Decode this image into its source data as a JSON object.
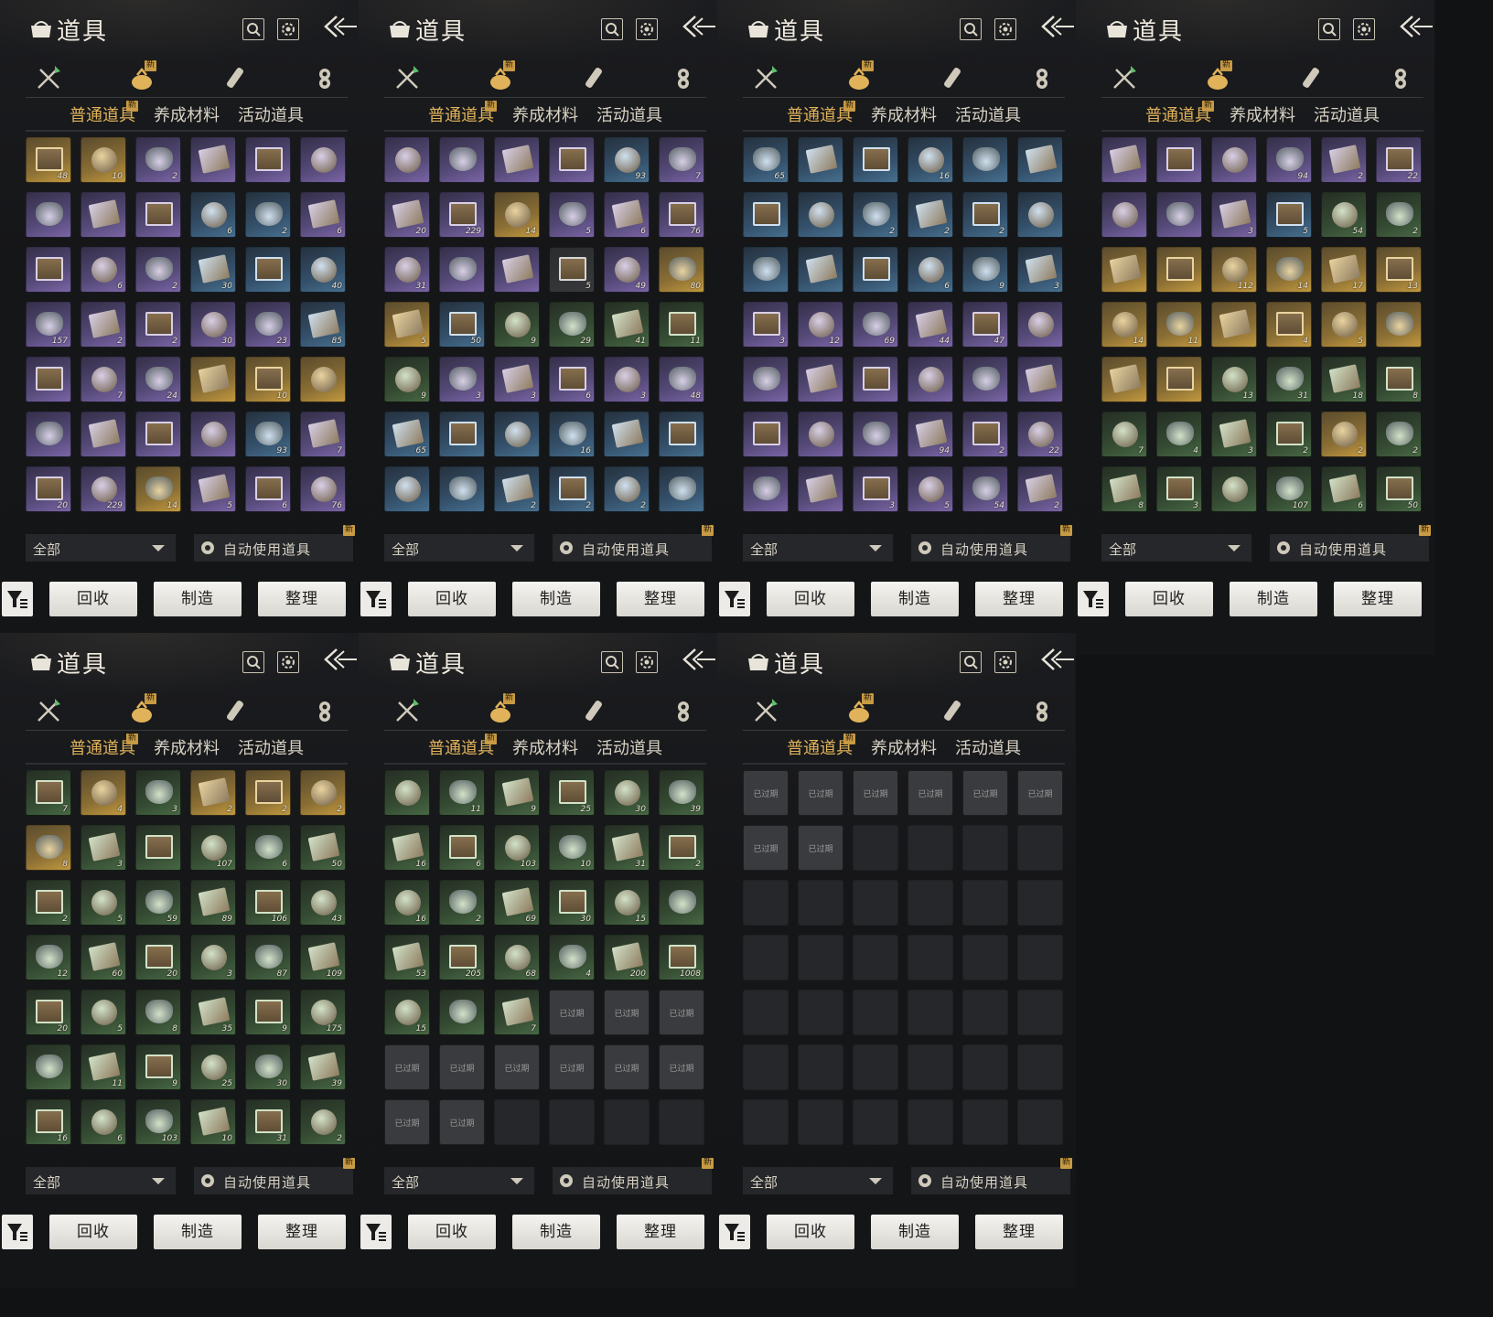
{
  "common": {
    "title": "道具",
    "new_badge": "新",
    "subtabs": [
      "普通道具",
      "养成材料",
      "活动道具"
    ],
    "filter_value": "全部",
    "auto_use_label": "自动使用道具",
    "buttons": {
      "recycle": "回收",
      "craft": "制造",
      "sort": "整理"
    },
    "expired_label": "已过期",
    "colors": {
      "accent": "#e0b25a",
      "badge": "#c79a44",
      "button": "#f4f3ef",
      "panel": "#17181a"
    }
  },
  "panels": [
    {
      "items": [
        {
          "r": "gold",
          "c": "48"
        },
        {
          "r": "gold",
          "c": "10"
        },
        {
          "r": "purple",
          "c": "2"
        },
        {
          "r": "purple",
          "c": ""
        },
        {
          "r": "purple",
          "c": ""
        },
        {
          "r": "purple",
          "c": ""
        },
        {
          "r": "purple",
          "c": ""
        },
        {
          "r": "purple",
          "c": ""
        },
        {
          "r": "purple",
          "c": ""
        },
        {
          "r": "blue",
          "c": "6"
        },
        {
          "r": "blue",
          "c": "2"
        },
        {
          "r": "purple",
          "c": "6"
        },
        {
          "r": "purple",
          "c": ""
        },
        {
          "r": "purple",
          "c": "6"
        },
        {
          "r": "purple",
          "c": "2"
        },
        {
          "r": "blue",
          "c": "30"
        },
        {
          "r": "blue",
          "c": ""
        },
        {
          "r": "blue",
          "c": "40"
        },
        {
          "r": "purple",
          "c": "157"
        },
        {
          "r": "purple",
          "c": "2"
        },
        {
          "r": "purple",
          "c": "2"
        },
        {
          "r": "purple",
          "c": "30"
        },
        {
          "r": "purple",
          "c": "23"
        },
        {
          "r": "blue",
          "c": "85"
        },
        {
          "r": "purple",
          "c": ""
        },
        {
          "r": "purple",
          "c": "7"
        },
        {
          "r": "purple",
          "c": "24"
        },
        {
          "r": "gold",
          "c": ""
        },
        {
          "r": "gold",
          "c": "10"
        },
        {
          "r": "gold",
          "c": ""
        },
        {
          "r": "purple",
          "c": ""
        },
        {
          "r": "purple",
          "c": ""
        },
        {
          "r": "purple",
          "c": ""
        },
        {
          "r": "purple",
          "c": ""
        },
        {
          "r": "blue",
          "c": "93"
        },
        {
          "r": "purple",
          "c": "7"
        },
        {
          "r": "purple",
          "c": "20"
        },
        {
          "r": "purple",
          "c": "229"
        },
        {
          "r": "gold",
          "c": "14"
        },
        {
          "r": "purple",
          "c": "5"
        },
        {
          "r": "purple",
          "c": "6"
        },
        {
          "r": "purple",
          "c": "76"
        }
      ]
    },
    {
      "items": [
        {
          "r": "purple",
          "c": ""
        },
        {
          "r": "purple",
          "c": ""
        },
        {
          "r": "purple",
          "c": ""
        },
        {
          "r": "purple",
          "c": ""
        },
        {
          "r": "blue",
          "c": "93"
        },
        {
          "r": "purple",
          "c": "7"
        },
        {
          "r": "purple",
          "c": "20"
        },
        {
          "r": "purple",
          "c": "229"
        },
        {
          "r": "gold",
          "c": "14"
        },
        {
          "r": "purple",
          "c": "5"
        },
        {
          "r": "purple",
          "c": "6"
        },
        {
          "r": "purple",
          "c": "76"
        },
        {
          "r": "purple",
          "c": "31"
        },
        {
          "r": "purple",
          "c": ""
        },
        {
          "r": "purple",
          "c": ""
        },
        {
          "r": "gray",
          "c": "5"
        },
        {
          "r": "purple",
          "c": "49"
        },
        {
          "r": "gold",
          "c": "80"
        },
        {
          "r": "gold",
          "c": "5"
        },
        {
          "r": "blue",
          "c": "50"
        },
        {
          "r": "green",
          "c": "9"
        },
        {
          "r": "green",
          "c": "29"
        },
        {
          "r": "green",
          "c": "41"
        },
        {
          "r": "green",
          "c": "11"
        },
        {
          "r": "green",
          "c": "9"
        },
        {
          "r": "purple",
          "c": "3"
        },
        {
          "r": "purple",
          "c": "3"
        },
        {
          "r": "purple",
          "c": "6"
        },
        {
          "r": "purple",
          "c": "3"
        },
        {
          "r": "purple",
          "c": "48"
        },
        {
          "r": "blue",
          "c": "65"
        },
        {
          "r": "blue",
          "c": ""
        },
        {
          "r": "blue",
          "c": ""
        },
        {
          "r": "blue",
          "c": "16"
        },
        {
          "r": "blue",
          "c": ""
        },
        {
          "r": "blue",
          "c": ""
        },
        {
          "r": "blue",
          "c": ""
        },
        {
          "r": "blue",
          "c": ""
        },
        {
          "r": "blue",
          "c": "2"
        },
        {
          "r": "blue",
          "c": "2"
        },
        {
          "r": "blue",
          "c": "2"
        },
        {
          "r": "blue",
          "c": ""
        }
      ]
    },
    {
      "items": [
        {
          "r": "blue",
          "c": "65"
        },
        {
          "r": "blue",
          "c": ""
        },
        {
          "r": "blue",
          "c": ""
        },
        {
          "r": "blue",
          "c": "16"
        },
        {
          "r": "blue",
          "c": ""
        },
        {
          "r": "blue",
          "c": ""
        },
        {
          "r": "blue",
          "c": ""
        },
        {
          "r": "blue",
          "c": ""
        },
        {
          "r": "blue",
          "c": "2"
        },
        {
          "r": "blue",
          "c": "2"
        },
        {
          "r": "blue",
          "c": "2"
        },
        {
          "r": "blue",
          "c": ""
        },
        {
          "r": "blue",
          "c": ""
        },
        {
          "r": "blue",
          "c": ""
        },
        {
          "r": "blue",
          "c": ""
        },
        {
          "r": "blue",
          "c": "6"
        },
        {
          "r": "blue",
          "c": "9"
        },
        {
          "r": "blue",
          "c": "3"
        },
        {
          "r": "purple",
          "c": "3"
        },
        {
          "r": "purple",
          "c": "12"
        },
        {
          "r": "purple",
          "c": "69"
        },
        {
          "r": "purple",
          "c": "44"
        },
        {
          "r": "purple",
          "c": "47"
        },
        {
          "r": "purple",
          "c": ""
        },
        {
          "r": "purple",
          "c": ""
        },
        {
          "r": "purple",
          "c": ""
        },
        {
          "r": "purple",
          "c": ""
        },
        {
          "r": "purple",
          "c": ""
        },
        {
          "r": "purple",
          "c": ""
        },
        {
          "r": "purple",
          "c": ""
        },
        {
          "r": "purple",
          "c": ""
        },
        {
          "r": "purple",
          "c": ""
        },
        {
          "r": "purple",
          "c": ""
        },
        {
          "r": "purple",
          "c": "94"
        },
        {
          "r": "purple",
          "c": "2"
        },
        {
          "r": "purple",
          "c": "22"
        },
        {
          "r": "purple",
          "c": ""
        },
        {
          "r": "purple",
          "c": ""
        },
        {
          "r": "purple",
          "c": "3"
        },
        {
          "r": "purple",
          "c": "5"
        },
        {
          "r": "purple",
          "c": "54"
        },
        {
          "r": "purple",
          "c": "2"
        }
      ]
    },
    {
      "items": [
        {
          "r": "purple",
          "c": ""
        },
        {
          "r": "purple",
          "c": ""
        },
        {
          "r": "purple",
          "c": ""
        },
        {
          "r": "purple",
          "c": "94"
        },
        {
          "r": "purple",
          "c": "2"
        },
        {
          "r": "purple",
          "c": "22"
        },
        {
          "r": "purple",
          "c": ""
        },
        {
          "r": "purple",
          "c": ""
        },
        {
          "r": "purple",
          "c": "3"
        },
        {
          "r": "blue",
          "c": "5"
        },
        {
          "r": "green",
          "c": "54"
        },
        {
          "r": "green",
          "c": "2"
        },
        {
          "r": "gold",
          "c": ""
        },
        {
          "r": "gold",
          "c": ""
        },
        {
          "r": "gold",
          "c": "112"
        },
        {
          "r": "gold",
          "c": "14"
        },
        {
          "r": "gold",
          "c": "17"
        },
        {
          "r": "gold",
          "c": "13"
        },
        {
          "r": "gold",
          "c": "14"
        },
        {
          "r": "gold",
          "c": "11"
        },
        {
          "r": "gold",
          "c": ""
        },
        {
          "r": "gold",
          "c": "4"
        },
        {
          "r": "gold",
          "c": "5"
        },
        {
          "r": "gold",
          "c": ""
        },
        {
          "r": "gold",
          "c": ""
        },
        {
          "r": "gold",
          "c": ""
        },
        {
          "r": "green",
          "c": "13"
        },
        {
          "r": "green",
          "c": "31"
        },
        {
          "r": "green",
          "c": "18"
        },
        {
          "r": "green",
          "c": "8"
        },
        {
          "r": "green",
          "c": "7"
        },
        {
          "r": "green",
          "c": "4"
        },
        {
          "r": "green",
          "c": "3"
        },
        {
          "r": "green",
          "c": "2"
        },
        {
          "r": "gold",
          "c": "2"
        },
        {
          "r": "green",
          "c": "2"
        },
        {
          "r": "green",
          "c": "8"
        },
        {
          "r": "green",
          "c": "3"
        },
        {
          "r": "green",
          "c": ""
        },
        {
          "r": "green",
          "c": "107"
        },
        {
          "r": "green",
          "c": "6"
        },
        {
          "r": "green",
          "c": "50"
        }
      ]
    },
    {
      "items": [
        {
          "r": "green",
          "c": "7"
        },
        {
          "r": "gold",
          "c": "4"
        },
        {
          "r": "green",
          "c": "3"
        },
        {
          "r": "gold",
          "c": "2"
        },
        {
          "r": "gold",
          "c": "2"
        },
        {
          "r": "gold",
          "c": "2"
        },
        {
          "r": "gold",
          "c": "8"
        },
        {
          "r": "green",
          "c": "3"
        },
        {
          "r": "green",
          "c": ""
        },
        {
          "r": "green",
          "c": "107"
        },
        {
          "r": "green",
          "c": "6"
        },
        {
          "r": "green",
          "c": "50"
        },
        {
          "r": "green",
          "c": "2"
        },
        {
          "r": "green",
          "c": "5"
        },
        {
          "r": "green",
          "c": "59"
        },
        {
          "r": "green",
          "c": "89"
        },
        {
          "r": "green",
          "c": "106"
        },
        {
          "r": "green",
          "c": "43"
        },
        {
          "r": "green",
          "c": "12"
        },
        {
          "r": "green",
          "c": "60"
        },
        {
          "r": "green",
          "c": "20"
        },
        {
          "r": "green",
          "c": "3"
        },
        {
          "r": "green",
          "c": "87"
        },
        {
          "r": "green",
          "c": "109"
        },
        {
          "r": "green",
          "c": "20"
        },
        {
          "r": "green",
          "c": "5"
        },
        {
          "r": "green",
          "c": "8"
        },
        {
          "r": "green",
          "c": "35"
        },
        {
          "r": "green",
          "c": "9"
        },
        {
          "r": "green",
          "c": "175"
        },
        {
          "r": "green",
          "c": ""
        },
        {
          "r": "green",
          "c": "11"
        },
        {
          "r": "green",
          "c": "9"
        },
        {
          "r": "green",
          "c": "25"
        },
        {
          "r": "green",
          "c": "30"
        },
        {
          "r": "green",
          "c": "39"
        },
        {
          "r": "green",
          "c": "16"
        },
        {
          "r": "green",
          "c": "6"
        },
        {
          "r": "green",
          "c": "103"
        },
        {
          "r": "green",
          "c": "10"
        },
        {
          "r": "green",
          "c": "31"
        },
        {
          "r": "green",
          "c": "2"
        }
      ]
    },
    {
      "items": [
        {
          "r": "green",
          "c": ""
        },
        {
          "r": "green",
          "c": "11"
        },
        {
          "r": "green",
          "c": "9"
        },
        {
          "r": "green",
          "c": "25"
        },
        {
          "r": "green",
          "c": "30"
        },
        {
          "r": "green",
          "c": "39"
        },
        {
          "r": "green",
          "c": "16"
        },
        {
          "r": "green",
          "c": "6"
        },
        {
          "r": "green",
          "c": "103"
        },
        {
          "r": "green",
          "c": "10"
        },
        {
          "r": "green",
          "c": "31"
        },
        {
          "r": "green",
          "c": "2"
        },
        {
          "r": "green",
          "c": "16"
        },
        {
          "r": "green",
          "c": "2"
        },
        {
          "r": "green",
          "c": "69"
        },
        {
          "r": "green",
          "c": "30"
        },
        {
          "r": "green",
          "c": "15"
        },
        {
          "r": "green",
          "c": ""
        },
        {
          "r": "green",
          "c": "53"
        },
        {
          "r": "green",
          "c": "205"
        },
        {
          "r": "green",
          "c": "68"
        },
        {
          "r": "green",
          "c": "4"
        },
        {
          "r": "green",
          "c": "200"
        },
        {
          "r": "green",
          "c": "1008"
        },
        {
          "r": "green",
          "c": "15"
        },
        {
          "r": "green",
          "c": ""
        },
        {
          "r": "green",
          "c": "7"
        },
        {
          "r": "expired",
          "c": ""
        },
        {
          "r": "expired",
          "c": ""
        },
        {
          "r": "expired",
          "c": ""
        },
        {
          "r": "expired",
          "c": ""
        },
        {
          "r": "expired",
          "c": ""
        },
        {
          "r": "expired",
          "c": ""
        },
        {
          "r": "expired",
          "c": ""
        },
        {
          "r": "expired",
          "c": ""
        },
        {
          "r": "expired",
          "c": ""
        },
        {
          "r": "expired",
          "c": ""
        },
        {
          "r": "expired",
          "c": ""
        },
        {
          "r": "empty",
          "c": ""
        },
        {
          "r": "empty",
          "c": ""
        },
        {
          "r": "empty",
          "c": ""
        },
        {
          "r": "empty",
          "c": ""
        }
      ]
    },
    {
      "items": [
        {
          "r": "expired",
          "c": ""
        },
        {
          "r": "expired",
          "c": ""
        },
        {
          "r": "expired",
          "c": ""
        },
        {
          "r": "expired",
          "c": ""
        },
        {
          "r": "expired",
          "c": ""
        },
        {
          "r": "expired",
          "c": ""
        },
        {
          "r": "expired",
          "c": ""
        },
        {
          "r": "expired",
          "c": ""
        },
        {
          "r": "empty",
          "c": ""
        },
        {
          "r": "empty",
          "c": ""
        },
        {
          "r": "empty",
          "c": ""
        },
        {
          "r": "empty",
          "c": ""
        },
        {
          "r": "empty",
          "c": ""
        },
        {
          "r": "empty",
          "c": ""
        },
        {
          "r": "empty",
          "c": ""
        },
        {
          "r": "empty",
          "c": ""
        },
        {
          "r": "empty",
          "c": ""
        },
        {
          "r": "empty",
          "c": ""
        },
        {
          "r": "empty",
          "c": ""
        },
        {
          "r": "empty",
          "c": ""
        },
        {
          "r": "empty",
          "c": ""
        },
        {
          "r": "empty",
          "c": ""
        },
        {
          "r": "empty",
          "c": ""
        },
        {
          "r": "empty",
          "c": ""
        },
        {
          "r": "empty",
          "c": ""
        },
        {
          "r": "empty",
          "c": ""
        },
        {
          "r": "empty",
          "c": ""
        },
        {
          "r": "empty",
          "c": ""
        },
        {
          "r": "empty",
          "c": ""
        },
        {
          "r": "empty",
          "c": ""
        },
        {
          "r": "empty",
          "c": ""
        },
        {
          "r": "empty",
          "c": ""
        },
        {
          "r": "empty",
          "c": ""
        },
        {
          "r": "empty",
          "c": ""
        },
        {
          "r": "empty",
          "c": ""
        },
        {
          "r": "empty",
          "c": ""
        },
        {
          "r": "empty",
          "c": ""
        },
        {
          "r": "empty",
          "c": ""
        },
        {
          "r": "empty",
          "c": ""
        },
        {
          "r": "empty",
          "c": ""
        },
        {
          "r": "empty",
          "c": ""
        },
        {
          "r": "empty",
          "c": ""
        }
      ]
    }
  ]
}
